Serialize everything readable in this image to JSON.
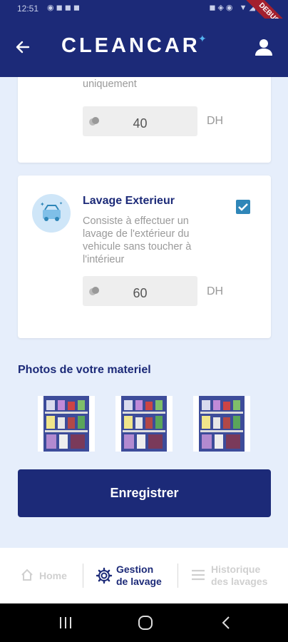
{
  "status_bar": {
    "time": "12:51",
    "debug_label": "DEBUG"
  },
  "app_bar": {
    "logo_text": "CLEANCAR"
  },
  "services": [
    {
      "description_tail": "uniquement",
      "price": "40",
      "unit": "DH"
    },
    {
      "title": "Lavage Exterieur",
      "description": "Consiste à effectuer un lavage de l'extérieur du vehicule sans toucher à l'intérieur",
      "price": "60",
      "unit": "DH",
      "checked": true
    }
  ],
  "photos_section": {
    "title": "Photos de votre materiel"
  },
  "save_button": {
    "label": "Enregistrer"
  },
  "bottom_nav": {
    "home": "Home",
    "gestion_line1": "Gestion",
    "gestion_line2": "de lavage",
    "historique_line1": "Historique",
    "historique_line2": "des lavages"
  },
  "colors": {
    "primary": "#1c2a78",
    "accent": "#2f86b8",
    "background": "#e6eefb",
    "muted": "#9a9a9a"
  },
  "icons": [
    "back-arrow-icon",
    "user-icon",
    "car-wash-icon",
    "coin-icon",
    "home-icon",
    "gear-icon",
    "menu-icon",
    "recent-apps-icon",
    "home-circle-icon",
    "back-chevron-icon"
  ]
}
